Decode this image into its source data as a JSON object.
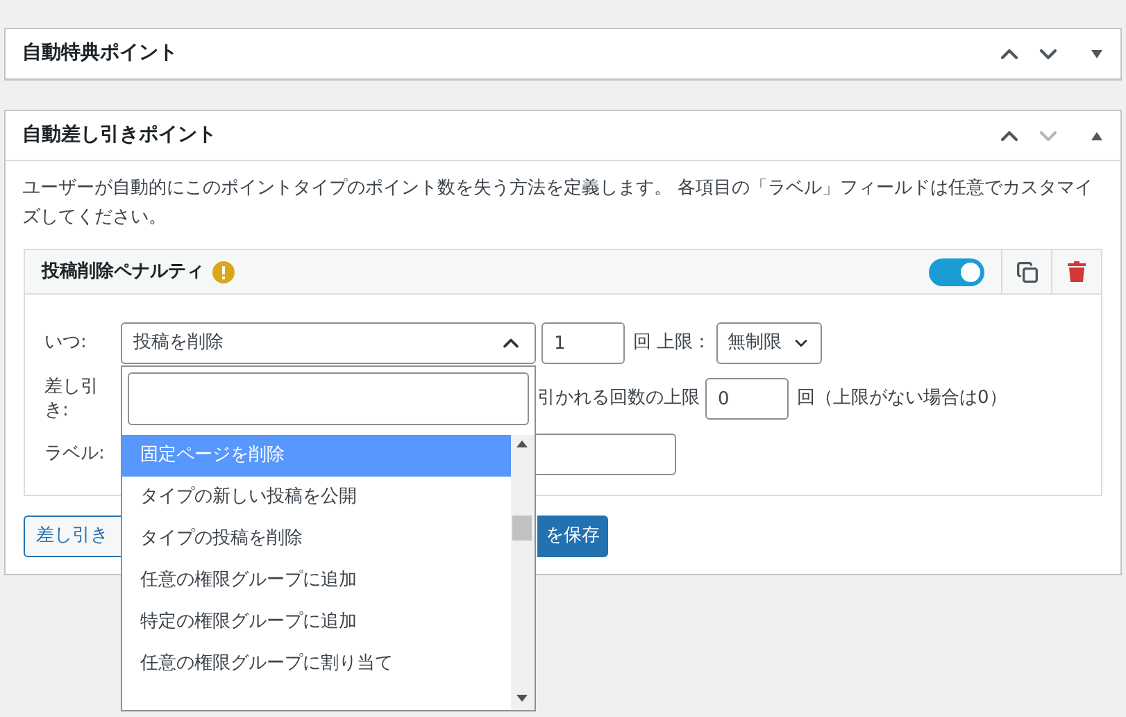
{
  "panels": [
    {
      "title": "自動特典ポイント",
      "expanded": false,
      "move_down_disabled": false
    },
    {
      "title": "自動差し引きポイント",
      "expanded": true,
      "move_down_disabled": true
    }
  ],
  "description": "ユーザーが自動的にこのポイントタイプのポイント数を失う方法を定義します。 各項目の「ラベル」フィールドは任意でカスタマイズしてください。",
  "hook": {
    "title": "投稿削除ペナルティ",
    "warning": true,
    "enabled": true,
    "when_label": "いつ:",
    "when_value": "投稿を削除",
    "count": "1",
    "count_unit": "回 上限：",
    "limit": "無制限",
    "deduct_label": "差し引き:",
    "max_label": "引かれる回数の上限",
    "max_value": "0",
    "max_unit": "回（上限がない場合は0）",
    "label_label": "ラベル:"
  },
  "buttons": [
    "差し引き",
    "を保存"
  ],
  "dropdown": {
    "open": true,
    "options": [
      {
        "label": "固定ページを削除",
        "selected": true
      },
      {
        "label": "タイプの新しい投稿を公開",
        "selected": false
      },
      {
        "label": "タイプの投稿を削除",
        "selected": false
      },
      {
        "label": "任意の権限グループに追加",
        "selected": false
      },
      {
        "label": "特定の権限グループに追加",
        "selected": false
      },
      {
        "label": "任意の権限グループに割り当て",
        "selected": false
      }
    ]
  }
}
